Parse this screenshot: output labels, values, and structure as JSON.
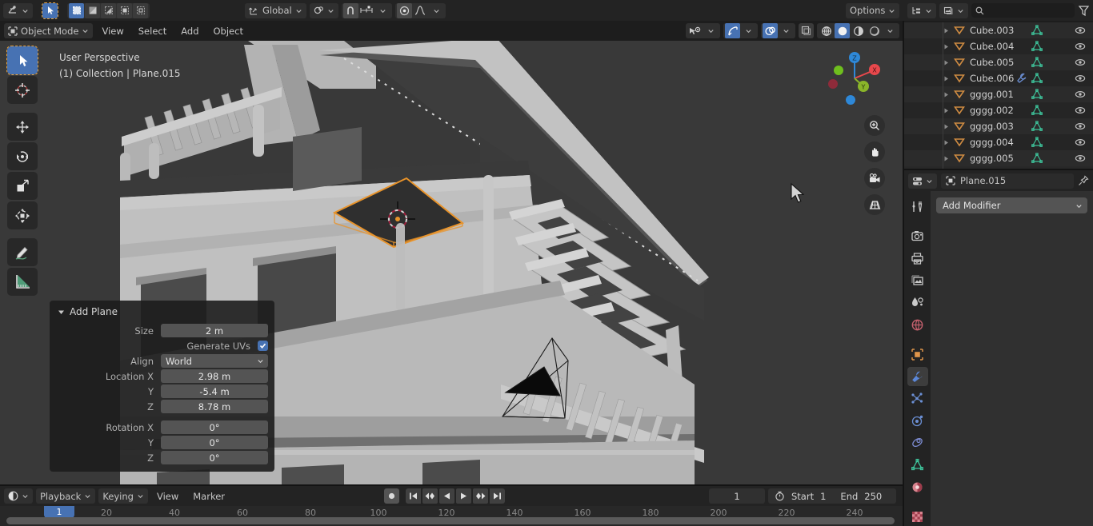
{
  "topbar": {
    "editor_icon": "editor-type-icon",
    "cursor_tool_icon": "select-cursor-icon",
    "select_modes": [
      "select-box-icon",
      "select-extend-icon",
      "select-subtract-icon",
      "select-invert-icon",
      "select-intersect-icon"
    ],
    "transform_orientation": "Global",
    "orientation_icon": "orientation-axis-icon",
    "pivot_icon": "pivot-point-icon",
    "snap_magnet_icon": "snap-magnet-icon",
    "snap_increment_icon": "snap-increment-icon",
    "proportional_icon": "proportional-edit-icon",
    "falloff_icon": "falloff-curve-icon",
    "options_label": "Options",
    "outliner_display_icon": "outliner-display-mode-icon",
    "outliner_filter_blend_icon": "outliner-blendfile-icon",
    "search_icon": "search-icon",
    "search_value": "",
    "search_placeholder": "",
    "filter_icon": "filter-funnel-icon"
  },
  "viewport_header": {
    "mode_icon": "object-mode-icon",
    "mode_label": "Object Mode",
    "menus": [
      "View",
      "Select",
      "Add",
      "Object"
    ],
    "right_icons": [
      "visibility-eye-icon",
      "gizmo-icon",
      "overlays-icon",
      "xray-toggle-icon"
    ],
    "shading_modes": [
      "shading-wireframe-icon",
      "shading-solid-icon",
      "shading-material-icon",
      "shading-rendered-icon"
    ],
    "shading_active": 1
  },
  "viewport": {
    "perspective_label": "User Perspective",
    "collection_label": "(1) Collection | Plane.015",
    "background_color": "#393939",
    "select_outline_color": "#e8932a",
    "gizmo_axes": [
      {
        "label": "X",
        "color": "#e8484c"
      },
      {
        "label": "Y",
        "color": "#8ab52a"
      },
      {
        "label": "Z",
        "color": "#2e88d8"
      }
    ],
    "nav_buttons": [
      "zoom-icon",
      "pan-hand-icon",
      "camera-view-icon",
      "toggle-perspective-icon"
    ],
    "tools": [
      "tweak-select-tool-icon",
      "cursor-tool-icon",
      "move-tool-icon",
      "rotate-tool-icon",
      "scale-tool-icon",
      "transform-tool-icon",
      "annotate-tool-icon",
      "measure-tool-icon"
    ],
    "active_tool_index": 0
  },
  "operator_panel": {
    "title": "Add Plane",
    "disclosure_icon": "triangle-down-icon",
    "rows": [
      {
        "label": "Size",
        "value": "2 m",
        "type": "field"
      },
      {
        "label": "Generate UVs",
        "value": "",
        "type": "checkbox",
        "checked": true
      },
      {
        "label": "Align",
        "value": "World",
        "type": "dropdown"
      },
      {
        "label": "Location X",
        "value": "2.98 m",
        "type": "field"
      },
      {
        "label": "Y",
        "value": "-5.4 m",
        "type": "field"
      },
      {
        "label": "Z",
        "value": "8.78 m",
        "type": "field"
      },
      {
        "label": "Rotation X",
        "value": "0°",
        "type": "field"
      },
      {
        "label": "Y",
        "value": "0°",
        "type": "field"
      },
      {
        "label": "Z",
        "value": "0°",
        "type": "field"
      }
    ]
  },
  "timeline": {
    "editor_icon": "timeline-editor-icon",
    "menus": [
      "Playback",
      "Keying",
      "View",
      "Marker"
    ],
    "transport_icons": [
      "record-icon",
      "jump-start-icon",
      "prev-keyframe-icon",
      "play-reverse-icon",
      "play-icon",
      "next-keyframe-icon",
      "jump-end-icon"
    ],
    "current_frame": "1",
    "clock_icon": "use-preview-range-icon",
    "start_label": "Start",
    "start_value": "1",
    "end_label": "End",
    "end_value": "250",
    "ruler_ticks": [
      "20",
      "40",
      "60",
      "80",
      "100",
      "120",
      "140",
      "160",
      "180",
      "200",
      "220",
      "240"
    ],
    "playhead_frame": "1",
    "playhead_color": "#4772b3"
  },
  "outliner": {
    "rows": [
      {
        "name": "Cube.003",
        "icons": [
          "mesh-data-icon"
        ],
        "eye": "hide-eye-icon"
      },
      {
        "name": "Cube.004",
        "icons": [
          "mesh-data-icon"
        ],
        "eye": "hide-eye-icon"
      },
      {
        "name": "Cube.005",
        "icons": [
          "mesh-data-icon"
        ],
        "eye": "hide-eye-icon"
      },
      {
        "name": "Cube.006",
        "icons": [
          "modifier-wrench-icon",
          "mesh-data-icon"
        ],
        "eye": "hide-eye-icon"
      },
      {
        "name": "gggg.001",
        "icons": [
          "mesh-data-icon"
        ],
        "eye": "hide-eye-icon"
      },
      {
        "name": "gggg.002",
        "icons": [
          "mesh-data-icon"
        ],
        "eye": "hide-eye-icon"
      },
      {
        "name": "gggg.003",
        "icons": [
          "mesh-data-icon"
        ],
        "eye": "hide-eye-icon"
      },
      {
        "name": "gggg.004",
        "icons": [
          "mesh-data-icon"
        ],
        "eye": "hide-eye-icon"
      },
      {
        "name": "gggg.005",
        "icons": [
          "mesh-data-icon"
        ],
        "eye": "hide-eye-icon"
      }
    ]
  },
  "properties": {
    "breadcrumb_icon": "object-icon",
    "breadcrumb_label": "Plane.015",
    "pin_icon": "pin-icon",
    "editor_icon": "properties-editor-icon",
    "add_modifier_label": "Add Modifier",
    "tabs": [
      {
        "name": "tool-tab-icon",
        "active": false
      },
      {
        "name": "render-tab-icon",
        "active": false
      },
      {
        "name": "output-tab-icon",
        "active": false
      },
      {
        "name": "viewlayer-tab-icon",
        "active": false
      },
      {
        "name": "scene-tab-icon",
        "active": false
      },
      {
        "name": "world-tab-icon",
        "active": false
      },
      {
        "name": "object-tab-icon",
        "active": false
      },
      {
        "name": "modifier-tab-icon",
        "active": true
      },
      {
        "name": "particles-tab-icon",
        "active": false
      },
      {
        "name": "physics-tab-icon",
        "active": false
      },
      {
        "name": "constraints-tab-icon",
        "active": false
      },
      {
        "name": "data-tab-icon",
        "active": false
      },
      {
        "name": "material-tab-icon",
        "active": false
      },
      {
        "name": "texture-tab-icon",
        "active": false
      }
    ]
  }
}
